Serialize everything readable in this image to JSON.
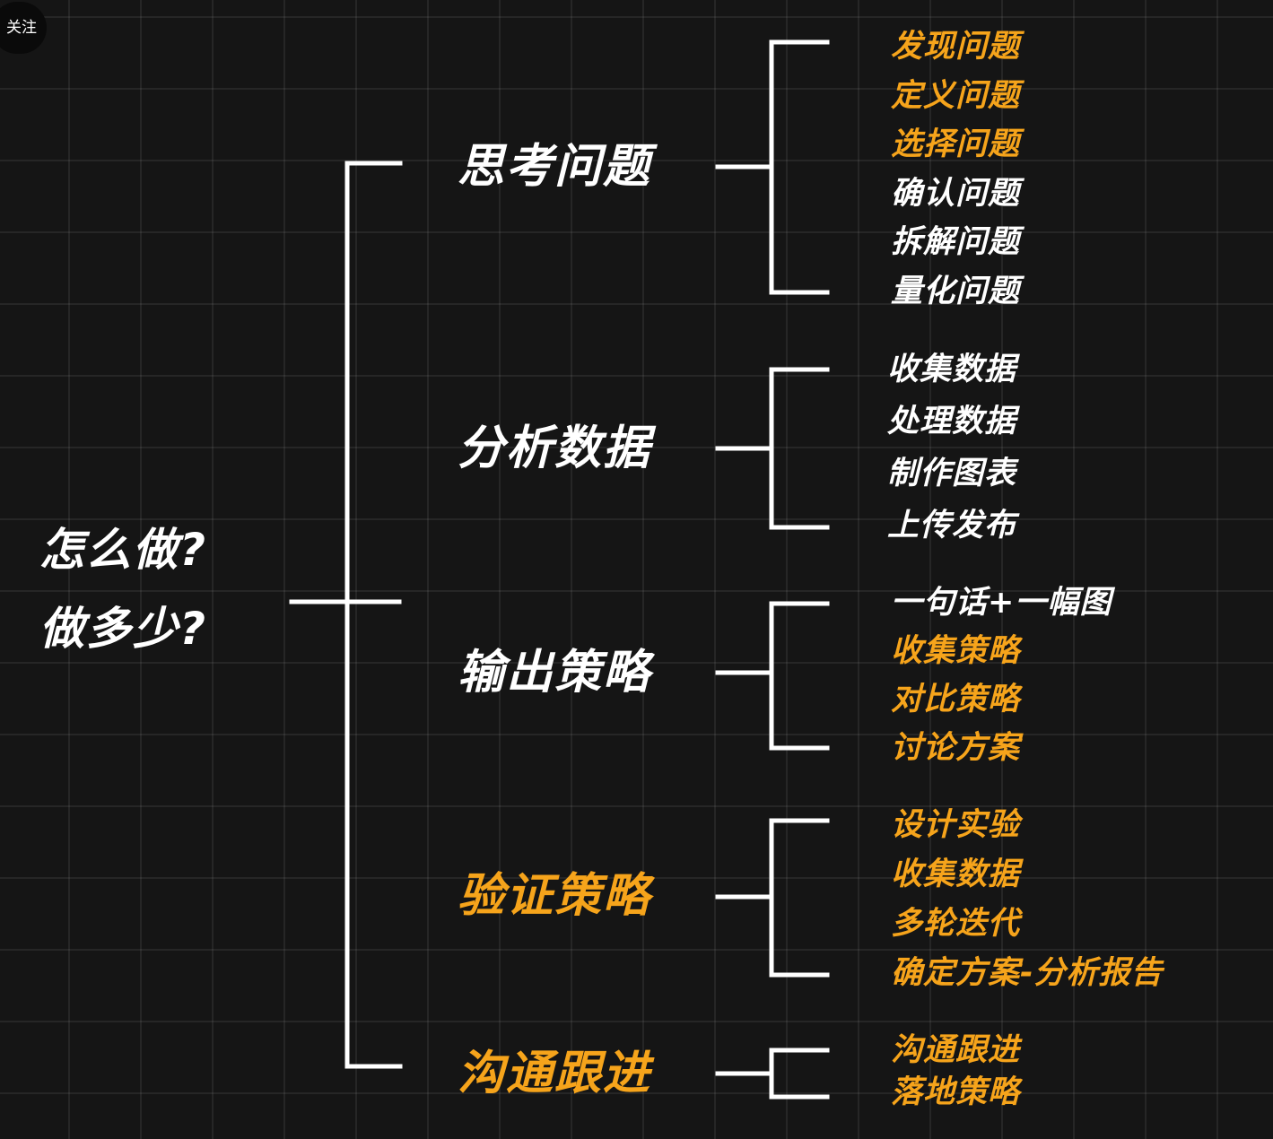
{
  "badge": "关注",
  "root": {
    "line1": "怎么做?",
    "line2": "做多少?"
  },
  "colors": {
    "background": "#151515",
    "line": "#ffffff",
    "accent": "#f6a41b",
    "text": "#ffffff"
  },
  "branches": [
    {
      "label": "思考问题",
      "color": "white",
      "leaves": [
        {
          "text": "发现问题",
          "color": "orange"
        },
        {
          "text": "定义问题",
          "color": "orange"
        },
        {
          "text": "选择问题",
          "color": "orange"
        },
        {
          "text": "确认问题",
          "color": "white"
        },
        {
          "text": "拆解问题",
          "color": "white"
        },
        {
          "text": "量化问题",
          "color": "white"
        }
      ]
    },
    {
      "label": "分析数据",
      "color": "white",
      "leaves": [
        {
          "text": "收集数据",
          "color": "white"
        },
        {
          "text": "处理数据",
          "color": "white"
        },
        {
          "text": "制作图表",
          "color": "white"
        },
        {
          "text": "上传发布",
          "color": "white"
        }
      ]
    },
    {
      "label": "输出策略",
      "color": "white",
      "leaves": [
        {
          "text": "一句话+一幅图",
          "color": "white"
        },
        {
          "text": "收集策略",
          "color": "orange"
        },
        {
          "text": "对比策略",
          "color": "orange"
        },
        {
          "text": "讨论方案",
          "color": "orange"
        }
      ]
    },
    {
      "label": "验证策略",
      "color": "orange",
      "leaves": [
        {
          "text": "设计实验",
          "color": "orange"
        },
        {
          "text": "收集数据",
          "color": "orange"
        },
        {
          "text": "多轮迭代",
          "color": "orange"
        },
        {
          "text": "确定方案-分析报告",
          "color": "orange"
        }
      ]
    },
    {
      "label": "沟通跟进",
      "color": "orange",
      "leaves": [
        {
          "text": "沟通跟进",
          "color": "orange"
        },
        {
          "text": "落地策略",
          "color": "orange"
        }
      ]
    }
  ]
}
